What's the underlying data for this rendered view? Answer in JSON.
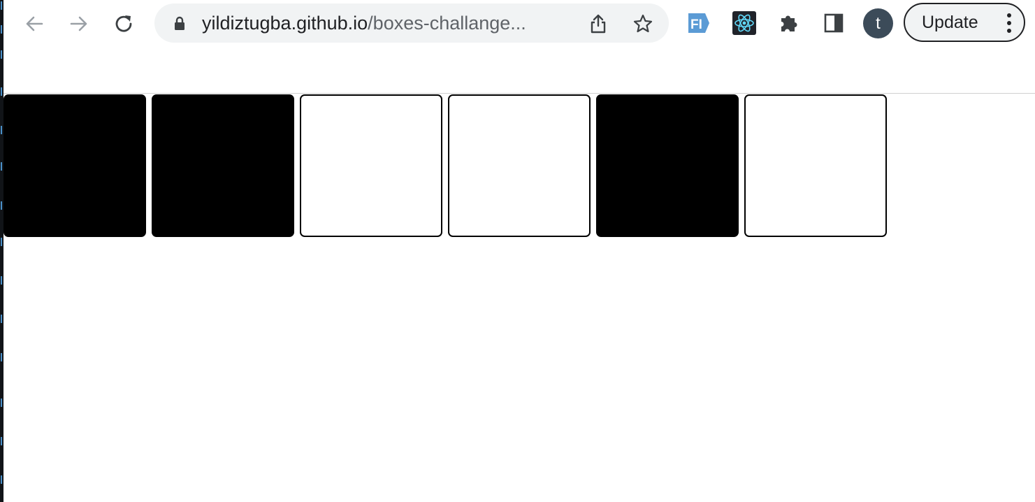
{
  "browser": {
    "url_host": "yildiztugba.github.io",
    "url_path": "/boxes-challange...",
    "avatar_letter": "t",
    "update_label": "Update",
    "icons": {
      "back": "arrow-left-icon",
      "forward": "arrow-right-icon",
      "reload": "reload-icon",
      "lock": "lock-icon",
      "share": "share-icon",
      "bookmark": "star-icon",
      "ext1": "fi-extension-icon",
      "ext2": "react-devtools-icon",
      "extensions": "puzzle-icon",
      "side_panel": "side-panel-icon",
      "menu": "kebab-menu-icon"
    }
  },
  "page": {
    "boxes": [
      {
        "state": "filled"
      },
      {
        "state": "filled"
      },
      {
        "state": "empty"
      },
      {
        "state": "empty"
      },
      {
        "state": "filled"
      },
      {
        "state": "empty"
      }
    ]
  },
  "colors": {
    "filled": "#000000",
    "empty": "#ffffff",
    "border": "#000000",
    "omnibox_bg": "#f1f3f4",
    "avatar_bg": "#3c4b59"
  }
}
